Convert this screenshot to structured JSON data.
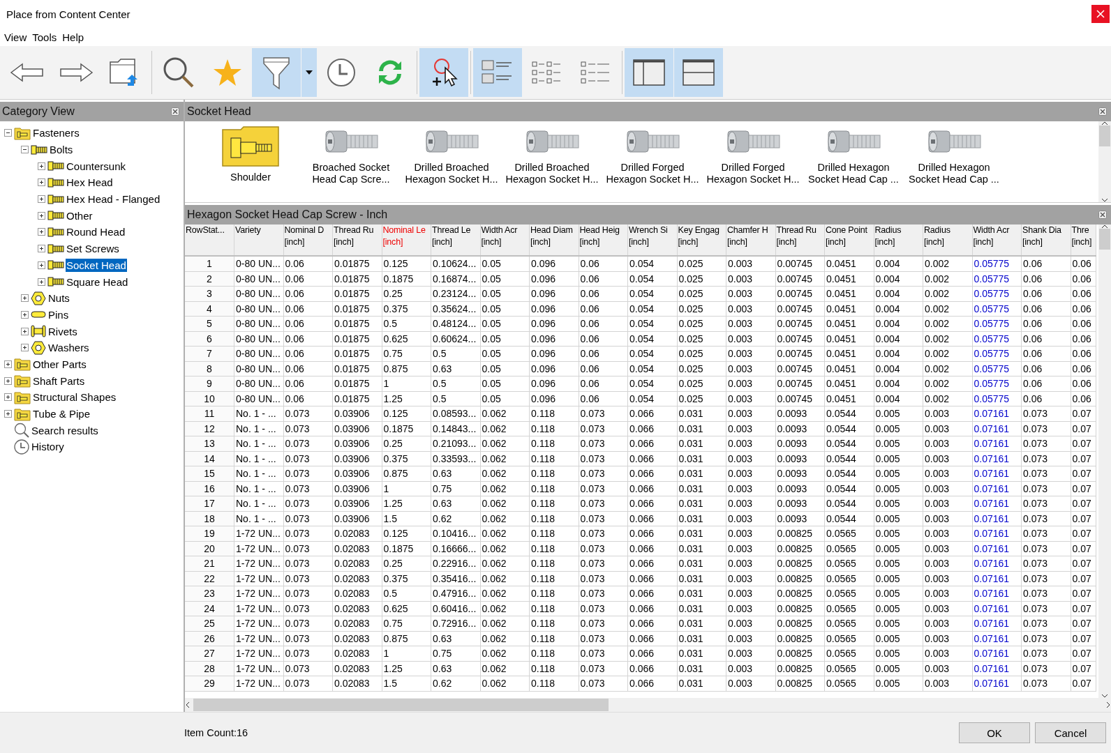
{
  "window": {
    "title": "Place from Content Center"
  },
  "menu": [
    "View",
    "Tools",
    "Help"
  ],
  "toolbar": [
    {
      "kind": "back",
      "selected": false
    },
    {
      "kind": "forward",
      "selected": false
    },
    {
      "kind": "folder-up",
      "selected": false
    },
    {
      "kind": "search",
      "selected": false
    },
    {
      "kind": "favorite",
      "selected": false
    },
    {
      "kind": "filter",
      "selected": true
    },
    {
      "kind": "dropdown",
      "selected": true
    },
    {
      "kind": "history",
      "selected": false
    },
    {
      "kind": "refresh",
      "selected": false
    },
    {
      "kind": "pick",
      "selected": true
    },
    {
      "kind": "thumbnails",
      "selected": true
    },
    {
      "kind": "list",
      "selected": false
    },
    {
      "kind": "details",
      "selected": false
    },
    {
      "kind": "split-vertical",
      "selected": true
    },
    {
      "kind": "split-horizontal",
      "selected": true
    }
  ],
  "category_view": {
    "title": "Category View",
    "tree": [
      {
        "label": "Fasteners",
        "kind": "folder",
        "expanded": true,
        "selected": false,
        "children": [
          {
            "label": "Bolts",
            "kind": "bolt",
            "expanded": true,
            "selected": false,
            "children": [
              {
                "label": "Countersunk",
                "kind": "bolt",
                "expanded": false,
                "selected": false
              },
              {
                "label": "Hex Head",
                "kind": "bolt",
                "expanded": false,
                "selected": false
              },
              {
                "label": "Hex Head - Flanged",
                "kind": "bolt",
                "expanded": false,
                "selected": false
              },
              {
                "label": "Other",
                "kind": "bolt",
                "expanded": false,
                "selected": false
              },
              {
                "label": "Round Head",
                "kind": "bolt",
                "expanded": false,
                "selected": false
              },
              {
                "label": "Set Screws",
                "kind": "bolt",
                "expanded": false,
                "selected": false
              },
              {
                "label": "Socket Head",
                "kind": "bolt",
                "expanded": false,
                "selected": true
              },
              {
                "label": "Square Head",
                "kind": "bolt",
                "expanded": false,
                "selected": false
              }
            ]
          },
          {
            "label": "Nuts",
            "kind": "nut",
            "expanded": false,
            "selected": false
          },
          {
            "label": "Pins",
            "kind": "pin",
            "expanded": false,
            "selected": false
          },
          {
            "label": "Rivets",
            "kind": "rivet",
            "expanded": false,
            "selected": false
          },
          {
            "label": "Washers",
            "kind": "nut",
            "expanded": false,
            "selected": false
          }
        ]
      },
      {
        "label": "Other Parts",
        "kind": "folder",
        "expanded": false,
        "selected": false
      },
      {
        "label": "Shaft Parts",
        "kind": "folder",
        "expanded": false,
        "selected": false
      },
      {
        "label": "Structural Shapes",
        "kind": "folder",
        "expanded": false,
        "selected": false
      },
      {
        "label": "Tube & Pipe",
        "kind": "folder",
        "expanded": false,
        "selected": false
      },
      {
        "label": "Search results",
        "kind": "search",
        "selected": false
      },
      {
        "label": "History",
        "kind": "history",
        "selected": false
      }
    ]
  },
  "family_view": {
    "title": "Socket Head",
    "items": [
      {
        "label": "Shoulder",
        "kind": "folder"
      },
      {
        "label": "Broached Socket Head Cap Scre...",
        "kind": "part"
      },
      {
        "label": "Drilled Broached Hexagon Socket H...",
        "kind": "part"
      },
      {
        "label": "Drilled Broached Hexagon Socket H...",
        "kind": "part"
      },
      {
        "label": "Drilled Forged Hexagon Socket H...",
        "kind": "part"
      },
      {
        "label": "Drilled Forged Hexagon Socket H...",
        "kind": "part"
      },
      {
        "label": "Drilled Hexagon Socket Head Cap ...",
        "kind": "part"
      },
      {
        "label": "Drilled Hexagon Socket Head Cap ...",
        "kind": "part"
      }
    ]
  },
  "table": {
    "title": "Hexagon Socket Head Cap Screw - Inch",
    "columns": [
      {
        "name": "RowStat...",
        "kind": "plain"
      },
      {
        "name": "Variety",
        "kind": "plain"
      },
      {
        "name": "Nominal D",
        "unit": "[inch]",
        "kind": "plain"
      },
      {
        "name": "Thread Ru",
        "unit": "[inch]",
        "kind": "plain"
      },
      {
        "name": "Nominal Le",
        "unit": "[inch]",
        "kind": "key"
      },
      {
        "name": "Thread Le",
        "unit": "[inch]",
        "kind": "plain"
      },
      {
        "name": "Width Acr",
        "unit": "[inch]",
        "kind": "plain"
      },
      {
        "name": "Head Diam",
        "unit": "[inch]",
        "kind": "plain"
      },
      {
        "name": "Head Heig",
        "unit": "[inch]",
        "kind": "plain"
      },
      {
        "name": "Wrench Si",
        "unit": "[inch]",
        "kind": "plain"
      },
      {
        "name": "Key Engag",
        "unit": "[inch]",
        "kind": "plain"
      },
      {
        "name": "Chamfer H",
        "unit": "[inch]",
        "kind": "plain"
      },
      {
        "name": "Thread Ru",
        "unit": "[inch]",
        "kind": "plain"
      },
      {
        "name": "Cone Point",
        "unit": "[inch]",
        "kind": "plain"
      },
      {
        "name": "Radius",
        "unit": "[inch]",
        "kind": "plain"
      },
      {
        "name": "Radius",
        "unit": "[inch]",
        "kind": "plain"
      },
      {
        "name": "Width Acr",
        "unit": "[inch]",
        "kind": "computed"
      },
      {
        "name": "Shank Dia",
        "unit": "[inch]",
        "kind": "plain"
      },
      {
        "name": "Thre",
        "unit": "[inch]",
        "kind": "plain"
      }
    ],
    "rows": [
      [
        "1",
        "0-80 UN...",
        "0.06",
        "0.01875",
        "0.125",
        "0.10624...",
        "0.05",
        "0.096",
        "0.06",
        "0.054",
        "0.025",
        "0.003",
        "0.00745",
        "0.0451",
        "0.004",
        "0.002",
        "0.05775",
        "0.06",
        "0.06"
      ],
      [
        "2",
        "0-80 UN...",
        "0.06",
        "0.01875",
        "0.1875",
        "0.16874...",
        "0.05",
        "0.096",
        "0.06",
        "0.054",
        "0.025",
        "0.003",
        "0.00745",
        "0.0451",
        "0.004",
        "0.002",
        "0.05775",
        "0.06",
        "0.06"
      ],
      [
        "3",
        "0-80 UN...",
        "0.06",
        "0.01875",
        "0.25",
        "0.23124...",
        "0.05",
        "0.096",
        "0.06",
        "0.054",
        "0.025",
        "0.003",
        "0.00745",
        "0.0451",
        "0.004",
        "0.002",
        "0.05775",
        "0.06",
        "0.06"
      ],
      [
        "4",
        "0-80 UN...",
        "0.06",
        "0.01875",
        "0.375",
        "0.35624...",
        "0.05",
        "0.096",
        "0.06",
        "0.054",
        "0.025",
        "0.003",
        "0.00745",
        "0.0451",
        "0.004",
        "0.002",
        "0.05775",
        "0.06",
        "0.06"
      ],
      [
        "5",
        "0-80 UN...",
        "0.06",
        "0.01875",
        "0.5",
        "0.48124...",
        "0.05",
        "0.096",
        "0.06",
        "0.054",
        "0.025",
        "0.003",
        "0.00745",
        "0.0451",
        "0.004",
        "0.002",
        "0.05775",
        "0.06",
        "0.06"
      ],
      [
        "6",
        "0-80 UN...",
        "0.06",
        "0.01875",
        "0.625",
        "0.60624...",
        "0.05",
        "0.096",
        "0.06",
        "0.054",
        "0.025",
        "0.003",
        "0.00745",
        "0.0451",
        "0.004",
        "0.002",
        "0.05775",
        "0.06",
        "0.06"
      ],
      [
        "7",
        "0-80 UN...",
        "0.06",
        "0.01875",
        "0.75",
        "0.5",
        "0.05",
        "0.096",
        "0.06",
        "0.054",
        "0.025",
        "0.003",
        "0.00745",
        "0.0451",
        "0.004",
        "0.002",
        "0.05775",
        "0.06",
        "0.06"
      ],
      [
        "8",
        "0-80 UN...",
        "0.06",
        "0.01875",
        "0.875",
        "0.63",
        "0.05",
        "0.096",
        "0.06",
        "0.054",
        "0.025",
        "0.003",
        "0.00745",
        "0.0451",
        "0.004",
        "0.002",
        "0.05775",
        "0.06",
        "0.06"
      ],
      [
        "9",
        "0-80 UN...",
        "0.06",
        "0.01875",
        "1",
        "0.5",
        "0.05",
        "0.096",
        "0.06",
        "0.054",
        "0.025",
        "0.003",
        "0.00745",
        "0.0451",
        "0.004",
        "0.002",
        "0.05775",
        "0.06",
        "0.06"
      ],
      [
        "10",
        "0-80 UN...",
        "0.06",
        "0.01875",
        "1.25",
        "0.5",
        "0.05",
        "0.096",
        "0.06",
        "0.054",
        "0.025",
        "0.003",
        "0.00745",
        "0.0451",
        "0.004",
        "0.002",
        "0.05775",
        "0.06",
        "0.06"
      ],
      [
        "11",
        "No. 1 - ...",
        "0.073",
        "0.03906",
        "0.125",
        "0.08593...",
        "0.062",
        "0.118",
        "0.073",
        "0.066",
        "0.031",
        "0.003",
        "0.0093",
        "0.0544",
        "0.005",
        "0.003",
        "0.07161",
        "0.073",
        "0.07"
      ],
      [
        "12",
        "No. 1 - ...",
        "0.073",
        "0.03906",
        "0.1875",
        "0.14843...",
        "0.062",
        "0.118",
        "0.073",
        "0.066",
        "0.031",
        "0.003",
        "0.0093",
        "0.0544",
        "0.005",
        "0.003",
        "0.07161",
        "0.073",
        "0.07"
      ],
      [
        "13",
        "No. 1 - ...",
        "0.073",
        "0.03906",
        "0.25",
        "0.21093...",
        "0.062",
        "0.118",
        "0.073",
        "0.066",
        "0.031",
        "0.003",
        "0.0093",
        "0.0544",
        "0.005",
        "0.003",
        "0.07161",
        "0.073",
        "0.07"
      ],
      [
        "14",
        "No. 1 - ...",
        "0.073",
        "0.03906",
        "0.375",
        "0.33593...",
        "0.062",
        "0.118",
        "0.073",
        "0.066",
        "0.031",
        "0.003",
        "0.0093",
        "0.0544",
        "0.005",
        "0.003",
        "0.07161",
        "0.073",
        "0.07"
      ],
      [
        "15",
        "No. 1 - ...",
        "0.073",
        "0.03906",
        "0.875",
        "0.63",
        "0.062",
        "0.118",
        "0.073",
        "0.066",
        "0.031",
        "0.003",
        "0.0093",
        "0.0544",
        "0.005",
        "0.003",
        "0.07161",
        "0.073",
        "0.07"
      ],
      [
        "16",
        "No. 1 - ...",
        "0.073",
        "0.03906",
        "1",
        "0.75",
        "0.062",
        "0.118",
        "0.073",
        "0.066",
        "0.031",
        "0.003",
        "0.0093",
        "0.0544",
        "0.005",
        "0.003",
        "0.07161",
        "0.073",
        "0.07"
      ],
      [
        "17",
        "No. 1 - ...",
        "0.073",
        "0.03906",
        "1.25",
        "0.63",
        "0.062",
        "0.118",
        "0.073",
        "0.066",
        "0.031",
        "0.003",
        "0.0093",
        "0.0544",
        "0.005",
        "0.003",
        "0.07161",
        "0.073",
        "0.07"
      ],
      [
        "18",
        "No. 1 - ...",
        "0.073",
        "0.03906",
        "1.5",
        "0.62",
        "0.062",
        "0.118",
        "0.073",
        "0.066",
        "0.031",
        "0.003",
        "0.0093",
        "0.0544",
        "0.005",
        "0.003",
        "0.07161",
        "0.073",
        "0.07"
      ],
      [
        "19",
        "1-72 UN...",
        "0.073",
        "0.02083",
        "0.125",
        "0.10416...",
        "0.062",
        "0.118",
        "0.073",
        "0.066",
        "0.031",
        "0.003",
        "0.00825",
        "0.0565",
        "0.005",
        "0.003",
        "0.07161",
        "0.073",
        "0.07"
      ],
      [
        "20",
        "1-72 UN...",
        "0.073",
        "0.02083",
        "0.1875",
        "0.16666...",
        "0.062",
        "0.118",
        "0.073",
        "0.066",
        "0.031",
        "0.003",
        "0.00825",
        "0.0565",
        "0.005",
        "0.003",
        "0.07161",
        "0.073",
        "0.07"
      ],
      [
        "21",
        "1-72 UN...",
        "0.073",
        "0.02083",
        "0.25",
        "0.22916...",
        "0.062",
        "0.118",
        "0.073",
        "0.066",
        "0.031",
        "0.003",
        "0.00825",
        "0.0565",
        "0.005",
        "0.003",
        "0.07161",
        "0.073",
        "0.07"
      ],
      [
        "22",
        "1-72 UN...",
        "0.073",
        "0.02083",
        "0.375",
        "0.35416...",
        "0.062",
        "0.118",
        "0.073",
        "0.066",
        "0.031",
        "0.003",
        "0.00825",
        "0.0565",
        "0.005",
        "0.003",
        "0.07161",
        "0.073",
        "0.07"
      ],
      [
        "23",
        "1-72 UN...",
        "0.073",
        "0.02083",
        "0.5",
        "0.47916...",
        "0.062",
        "0.118",
        "0.073",
        "0.066",
        "0.031",
        "0.003",
        "0.00825",
        "0.0565",
        "0.005",
        "0.003",
        "0.07161",
        "0.073",
        "0.07"
      ],
      [
        "24",
        "1-72 UN...",
        "0.073",
        "0.02083",
        "0.625",
        "0.60416...",
        "0.062",
        "0.118",
        "0.073",
        "0.066",
        "0.031",
        "0.003",
        "0.00825",
        "0.0565",
        "0.005",
        "0.003",
        "0.07161",
        "0.073",
        "0.07"
      ],
      [
        "25",
        "1-72 UN...",
        "0.073",
        "0.02083",
        "0.75",
        "0.72916...",
        "0.062",
        "0.118",
        "0.073",
        "0.066",
        "0.031",
        "0.003",
        "0.00825",
        "0.0565",
        "0.005",
        "0.003",
        "0.07161",
        "0.073",
        "0.07"
      ],
      [
        "26",
        "1-72 UN...",
        "0.073",
        "0.02083",
        "0.875",
        "0.63",
        "0.062",
        "0.118",
        "0.073",
        "0.066",
        "0.031",
        "0.003",
        "0.00825",
        "0.0565",
        "0.005",
        "0.003",
        "0.07161",
        "0.073",
        "0.07"
      ],
      [
        "27",
        "1-72 UN...",
        "0.073",
        "0.02083",
        "1",
        "0.75",
        "0.062",
        "0.118",
        "0.073",
        "0.066",
        "0.031",
        "0.003",
        "0.00825",
        "0.0565",
        "0.005",
        "0.003",
        "0.07161",
        "0.073",
        "0.07"
      ],
      [
        "28",
        "1-72 UN...",
        "0.073",
        "0.02083",
        "1.25",
        "0.63",
        "0.062",
        "0.118",
        "0.073",
        "0.066",
        "0.031",
        "0.003",
        "0.00825",
        "0.0565",
        "0.005",
        "0.003",
        "0.07161",
        "0.073",
        "0.07"
      ],
      [
        "29",
        "1-72 UN...",
        "0.073",
        "0.02083",
        "1.5",
        "0.62",
        "0.062",
        "0.118",
        "0.073",
        "0.066",
        "0.031",
        "0.003",
        "0.00825",
        "0.0565",
        "0.005",
        "0.003",
        "0.07161",
        "0.073",
        "0.07"
      ]
    ]
  },
  "status_bar": {
    "item_count": "Item Count:16"
  },
  "buttons": [
    "OK",
    "Cancel"
  ]
}
